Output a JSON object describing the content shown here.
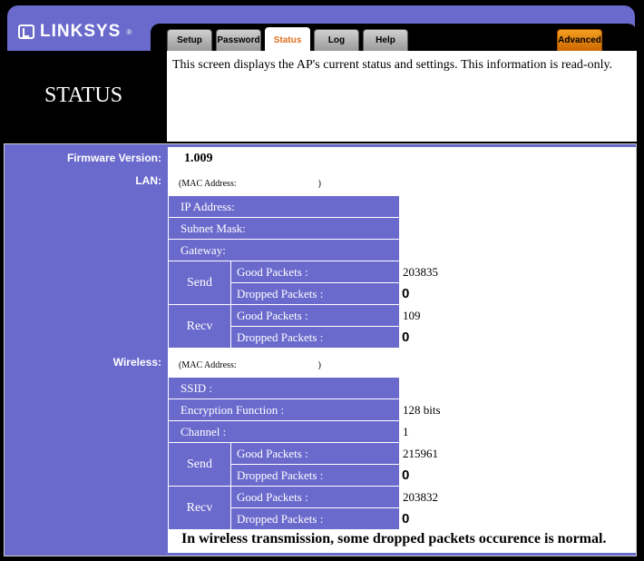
{
  "brand": {
    "name": "LINKSYS",
    "reg": "®"
  },
  "tabs": [
    {
      "label": "Setup",
      "active": false
    },
    {
      "label": "Password",
      "active": false
    },
    {
      "label": "Status",
      "active": true
    },
    {
      "label": "Log",
      "active": false
    },
    {
      "label": "Help",
      "active": false
    }
  ],
  "advanced_label": "Advanced",
  "page": {
    "title": "STATUS",
    "description": "This screen displays the AP's current status and settings. This information is read-only."
  },
  "firmware": {
    "label": "Firmware Version:",
    "value": "1.009"
  },
  "lan": {
    "label": "LAN:",
    "mac": "(MAC Address:                                    )",
    "ip_label": "IP Address:",
    "subnet_label": "Subnet Mask:",
    "gateway_label": "Gateway:",
    "send": {
      "label": "Send",
      "good_label": "Good Packets :",
      "good": "203835",
      "dropped_label": "Dropped Packets :",
      "dropped": "0"
    },
    "recv": {
      "label": "Recv",
      "good_label": "Good Packets :",
      "good": "109",
      "dropped_label": "Dropped Packets :",
      "dropped": "0"
    }
  },
  "wireless": {
    "label": "Wireless:",
    "mac": "(MAC Address:                                    )",
    "ssid_label": "SSID :",
    "enc_label": "Encryption Function :",
    "enc_value": "128 bits",
    "channel_label": "Channel :",
    "channel_value": "1",
    "send": {
      "label": "Send",
      "good_label": "Good Packets :",
      "good": "215961",
      "dropped_label": "Dropped Packets :",
      "dropped": "0"
    },
    "recv": {
      "label": "Recv",
      "good_label": "Good Packets :",
      "good": "203832",
      "dropped_label": "Dropped Packets :",
      "dropped": "0"
    }
  },
  "note": "In wireless transmission, some dropped packets occurence is normal.",
  "colors": {
    "accent": "#6a6acd",
    "active_tab_text": "#e07020",
    "advanced": "#f4a020"
  }
}
